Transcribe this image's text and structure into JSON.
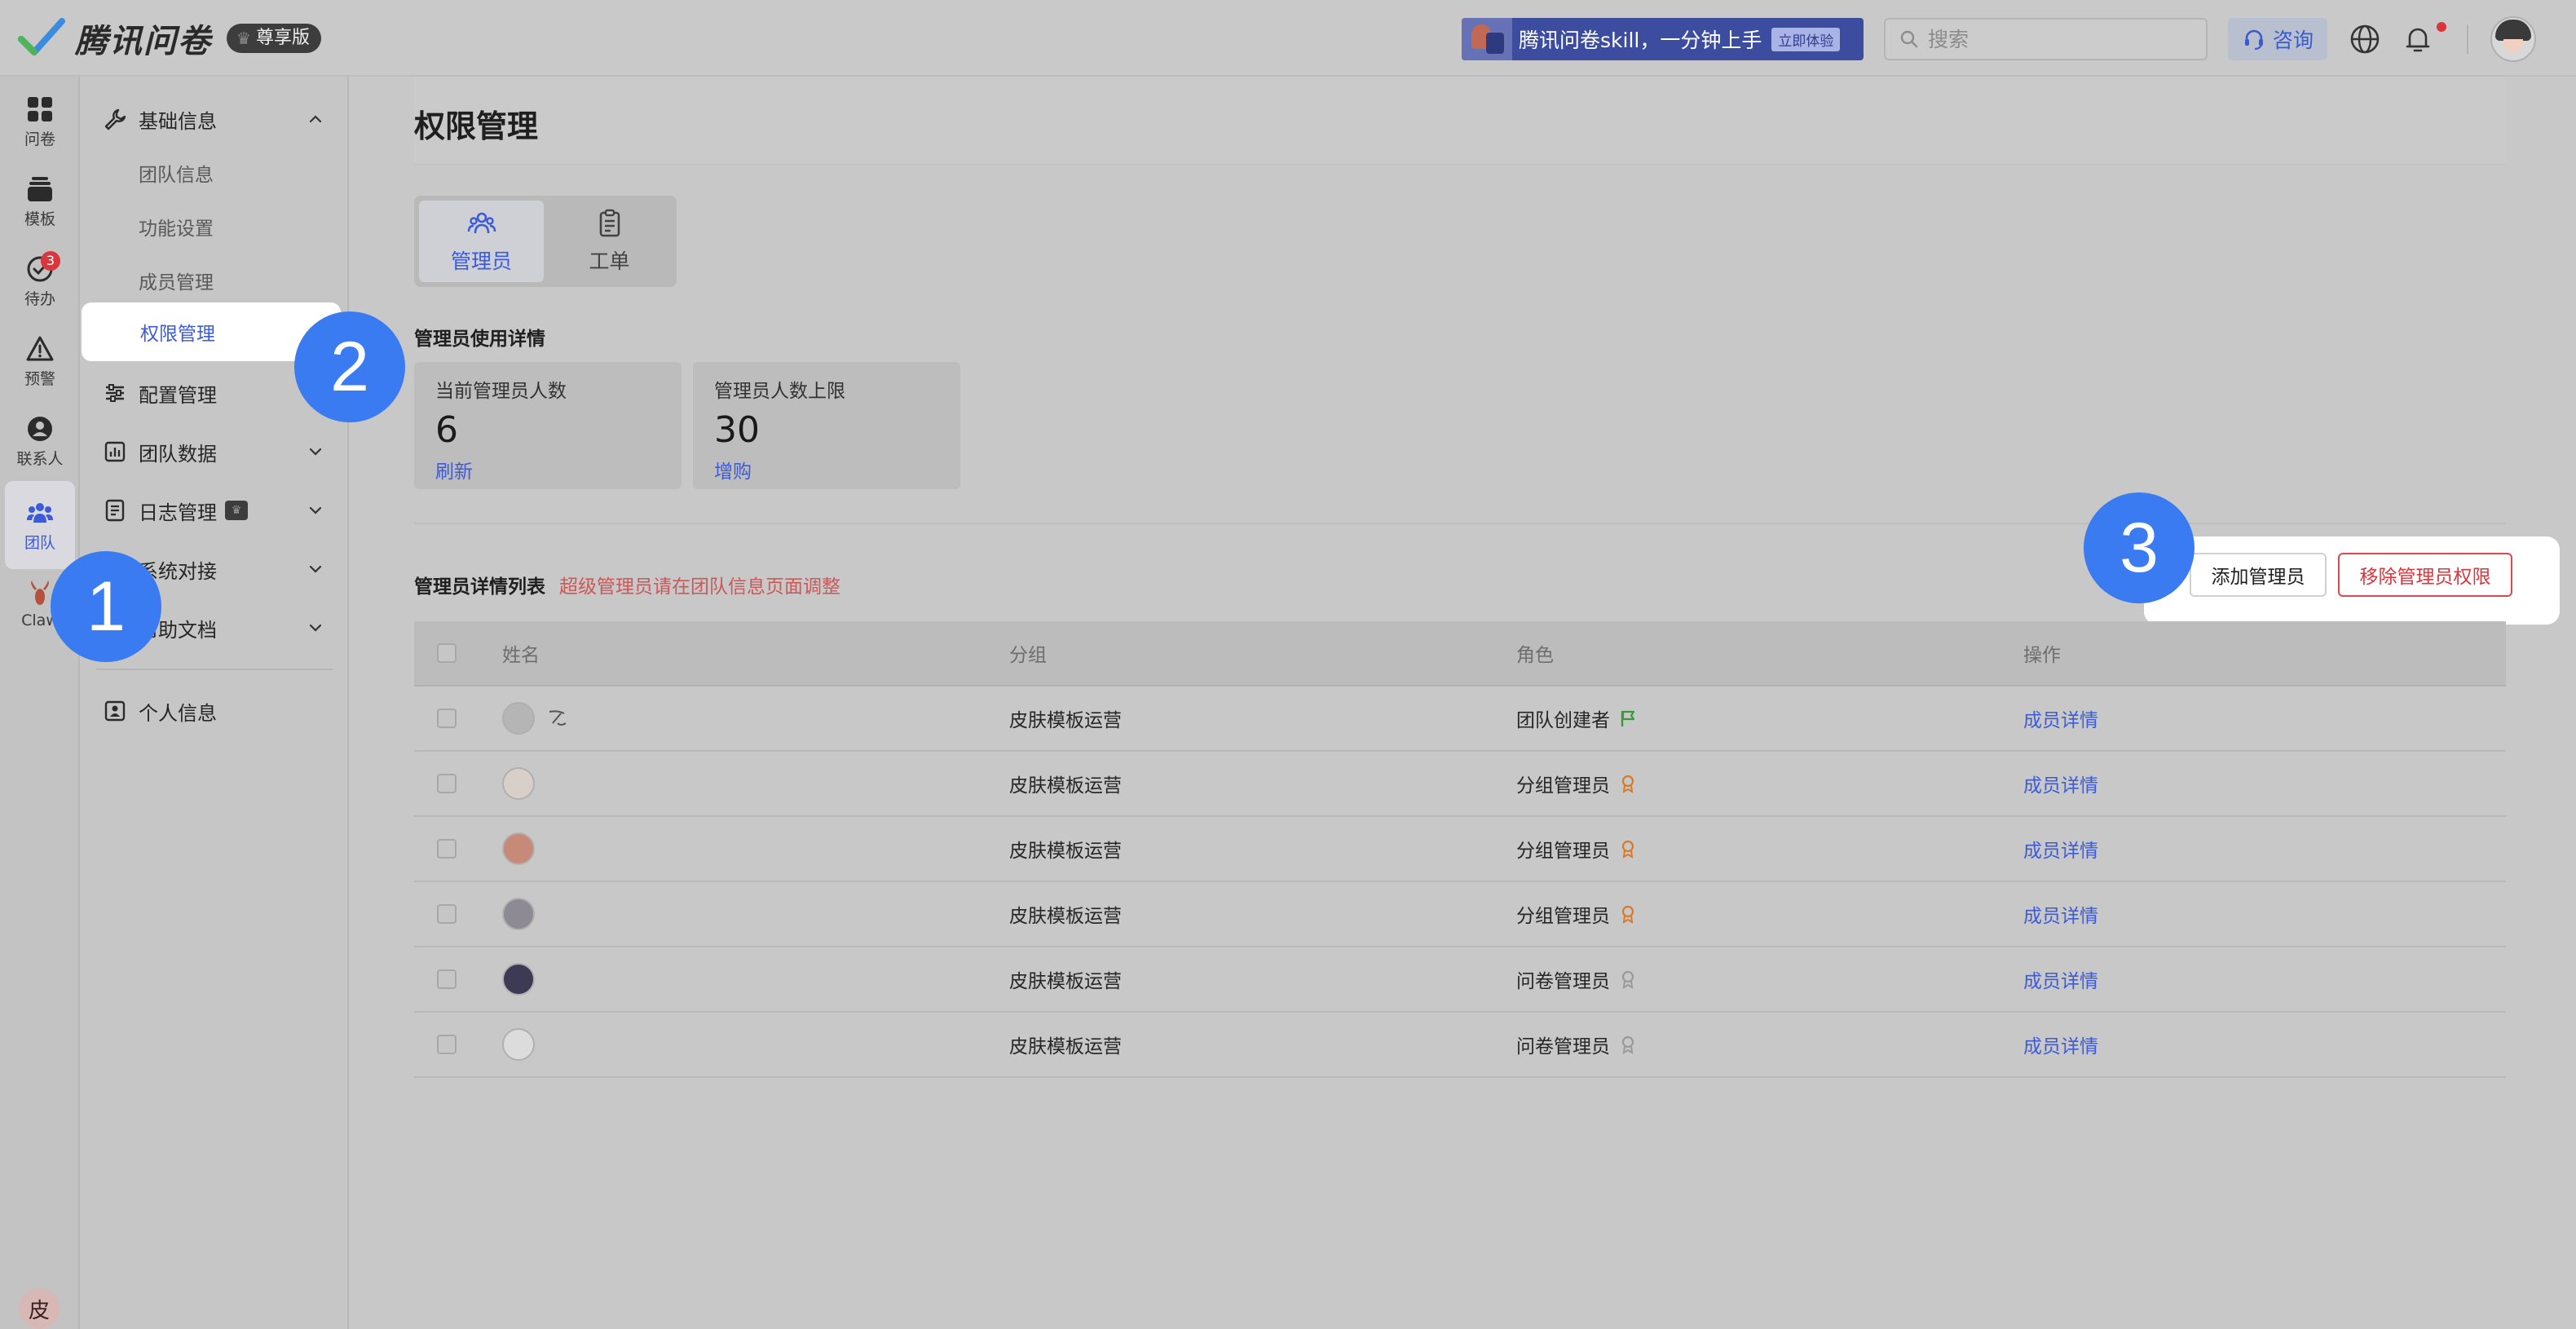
{
  "header": {
    "logo_text": "腾讯问卷",
    "edition": "尊享版",
    "promo_text": "腾讯问卷skill，一分钟上手",
    "promo_cta": "立即体验",
    "search_placeholder": "搜索",
    "consult_label": "咨询"
  },
  "rail": {
    "items": [
      {
        "label": "问卷",
        "icon": "grid-icon"
      },
      {
        "label": "模板",
        "icon": "template-icon"
      },
      {
        "label": "待办",
        "icon": "todo-icon",
        "badge": "3"
      },
      {
        "label": "预警",
        "icon": "warning-icon"
      },
      {
        "label": "联系人",
        "icon": "contact-icon"
      },
      {
        "label": "团队",
        "icon": "team-icon",
        "active": true
      },
      {
        "label": "Claw",
        "icon": "lobster-icon"
      }
    ],
    "user_initial": "皮"
  },
  "sidenav": {
    "basic_info": "基础信息",
    "sub_items": [
      "团队信息",
      "功能设置",
      "成员管理",
      "权限管理"
    ],
    "config": "配置管理",
    "team_data": "团队数据",
    "logs": "日志管理",
    "system": "系统对接",
    "help": "帮助文档",
    "profile": "个人信息"
  },
  "main": {
    "title": "权限管理",
    "tabs": [
      {
        "label": "管理员",
        "icon": "admins-icon",
        "active": true
      },
      {
        "label": "工单",
        "icon": "clipboard-icon",
        "active": false
      }
    ],
    "usage_title": "管理员使用详情",
    "stats": [
      {
        "label": "当前管理员人数",
        "value": "6",
        "link": "刷新"
      },
      {
        "label": "管理员人数上限",
        "value": "30",
        "link": "增购"
      }
    ],
    "list_title": "管理员详情列表",
    "list_note": "超级管理员请在团队信息页面调整",
    "add_button": "添加管理员",
    "remove_button": "移除管理员权限",
    "columns": [
      "姓名",
      "分组",
      "角色",
      "操作"
    ],
    "rows": [
      {
        "group": "皮肤模板运营",
        "role": "团队创建者",
        "role_icon": "flag-icon",
        "op": "成员详情"
      },
      {
        "group": "皮肤模板运营",
        "role": "分组管理员",
        "role_icon": "medal-icon",
        "op": "成员详情"
      },
      {
        "group": "皮肤模板运营",
        "role": "分组管理员",
        "role_icon": "medal-icon",
        "op": "成员详情"
      },
      {
        "group": "皮肤模板运营",
        "role": "分组管理员",
        "role_icon": "medal-icon",
        "op": "成员详情"
      },
      {
        "group": "皮肤模板运营",
        "role": "问卷管理员",
        "role_icon": "medal-outline-icon",
        "op": "成员详情"
      },
      {
        "group": "皮肤模板运营",
        "role": "问卷管理员",
        "role_icon": "medal-outline-icon",
        "op": "成员详情"
      }
    ]
  },
  "annotations": [
    "1",
    "2",
    "3"
  ],
  "colors": {
    "accent": "#3c5bd8",
    "danger": "#d9363e",
    "marker": "#3a7bf2",
    "note": "#c85a5a"
  }
}
